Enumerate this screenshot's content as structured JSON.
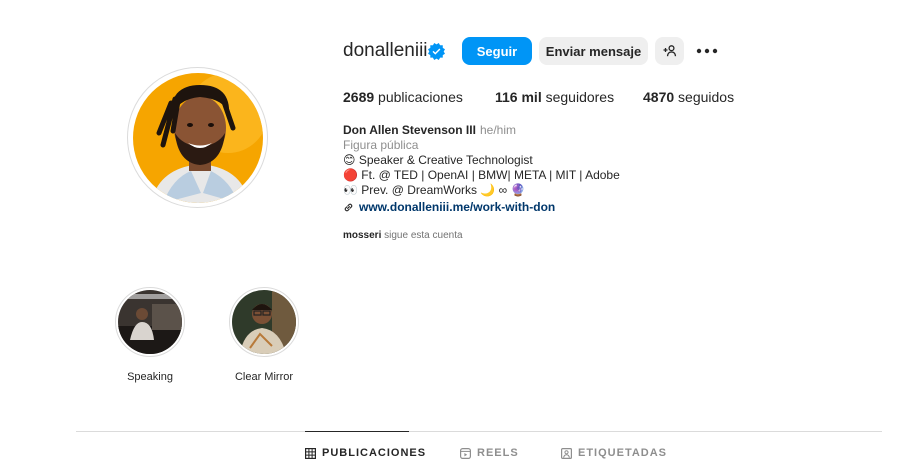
{
  "profile": {
    "username": "donalleniii",
    "full_name": "Don Allen Stevenson III",
    "pronouns": "he/him",
    "category": "Figura pública",
    "bio_lines": [
      "😊 Speaker & Creative Technologist",
      "🔴 Ft. @ TED | OpenAI | BMW| META | MIT | Adobe",
      "👀 Prev. @ DreamWorks 🌙 ∞ 🔮"
    ],
    "website": "www.donalleniii.me/work-with-don",
    "followed_by_user": "mosseri",
    "followed_by_text": "sigue esta cuenta"
  },
  "actions": {
    "follow_label": "Seguir",
    "message_label": "Enviar mensaje"
  },
  "stats": {
    "posts_value": "2689",
    "posts_label": "publicaciones",
    "followers_value": "116 mil",
    "followers_label": "seguidores",
    "following_value": "4870",
    "following_label": "seguidos"
  },
  "highlights": [
    {
      "label": "Speaking"
    },
    {
      "label": "Clear Mirror"
    }
  ],
  "tabs": [
    {
      "label": "PUBLICACIONES"
    },
    {
      "label": "REELS"
    },
    {
      "label": "ETIQUETADAS"
    }
  ],
  "colors": {
    "accent": "#0095f6",
    "link": "#00376b",
    "avatar_bg": "#f6a500"
  }
}
